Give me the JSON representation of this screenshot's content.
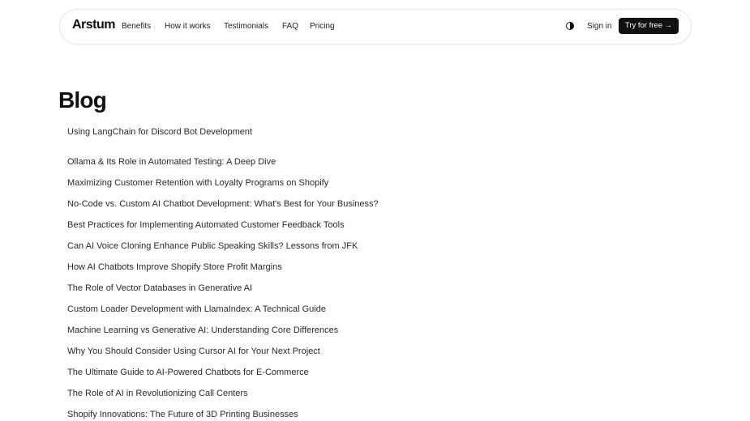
{
  "nav": {
    "logo": "Arstum",
    "links": [
      "Benefits",
      "How it works",
      "Testimonials",
      "FAQ",
      "Pricing"
    ],
    "theme_icon": "half-circle-contrast-icon",
    "sign_in": "Sign in",
    "cta": "Try for free →"
  },
  "main": {
    "title": "Blog",
    "posts": [
      "Using LangChain for Discord Bot Development",
      "Ollama & Its Role in Automated Testing: A Deep Dive",
      "Maximizing Customer Retention with Loyalty Programs on Shopify",
      "No-Code vs. Custom AI Chatbot Development: What's Best for Your Business?",
      "Best Practices for Implementing Automated Customer Feedback Tools",
      "Can AI Voice Cloning Enhance Public Speaking Skills? Lessons from JFK",
      "How AI Chatbots Improve Shopify Store Profit Margins",
      "The Role of Vector Databases in Generative AI",
      "Custom Loader Development with LlamaIndex: A Technical Guide",
      "Machine Learning vs Generative AI: Understanding Core Differences",
      "Why You Should Consider Using Cursor AI for Your Next Project",
      "The Ultimate Guide to AI-Powered Chatbots for E-Commerce",
      "The Role of AI in Revolutionizing Call Centers",
      "Shopify Innovations: The Future of 3D Printing Businesses"
    ]
  }
}
